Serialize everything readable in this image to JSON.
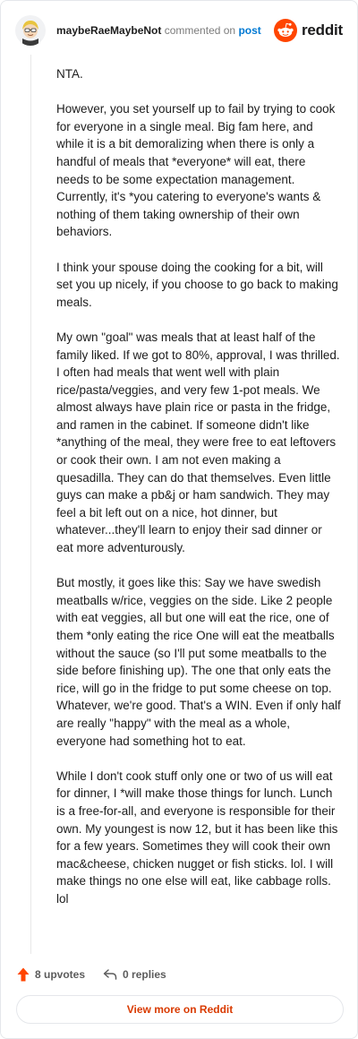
{
  "header": {
    "author": "maybeRaeMaybeNot",
    "action": "commented on",
    "target": "post",
    "brand": "reddit"
  },
  "comment": {
    "paragraphs": [
      "NTA.",
      "However, you set yourself up to fail by trying to cook for everyone in a single meal. Big fam here, and while it is a bit demoralizing when there is only a handful of meals that *everyone* will eat, there needs to be some expectation management. Currently, it's *you catering to everyone's wants & nothing of them taking ownership of their own behaviors.",
      "I think your spouse doing the cooking for a bit, will set you up nicely, if you choose to go back to making meals.",
      "My own \"goal\" was meals that at least half of the family liked. If we got to 80%, approval, I was thrilled. I often had meals that went well with plain rice/pasta/veggies, and very few 1-pot meals. We almost always have plain rice or pasta in the fridge, and ramen in the cabinet. If someone didn't like *anything of the meal, they were free to eat leftovers or cook their own. I am not even making a quesadilla. They can do that themselves. Even little guys can make a pb&j or ham sandwich. They may feel a bit left out on a nice, hot dinner, but whatever...they'll learn to enjoy their sad dinner or eat more adventurously.",
      "But mostly, it goes like this: Say we have swedish meatballs w/rice, veggies on the side. Like 2 people with eat veggies, all but one will eat the rice, one of them *only eating the rice One will eat the meatballs without the sauce (so I'll put some meatballs to the side before finishing up). The one that only eats the rice, will go in the fridge to put some cheese on top. Whatever, we're good. That's a WIN. Even if only half are really \"happy\" with the meal as a whole, everyone had something hot to eat.",
      "While I don't cook stuff only one or two of us will eat for dinner, I *will make those things for lunch. Lunch is a free-for-all, and everyone is responsible for their own. My youngest is now 12, but it has been like this for a few years. Sometimes they will cook their own mac&cheese, chicken nugget or fish sticks. lol. I will make things no one else will eat, like cabbage rolls. lol"
    ]
  },
  "footer": {
    "upvotes": "8 upvotes",
    "replies": "0 replies",
    "view_more": "View more on Reddit"
  },
  "icons": {
    "upvote": "upvote-arrow-icon",
    "reply": "reply-arrow-icon",
    "brand": "reddit-snoo-icon",
    "avatar": "user-avatar"
  },
  "colors": {
    "upvote": "#ff4500",
    "link": "#0079d3",
    "view_more": "#d93a00",
    "brand": "#ff4500"
  }
}
